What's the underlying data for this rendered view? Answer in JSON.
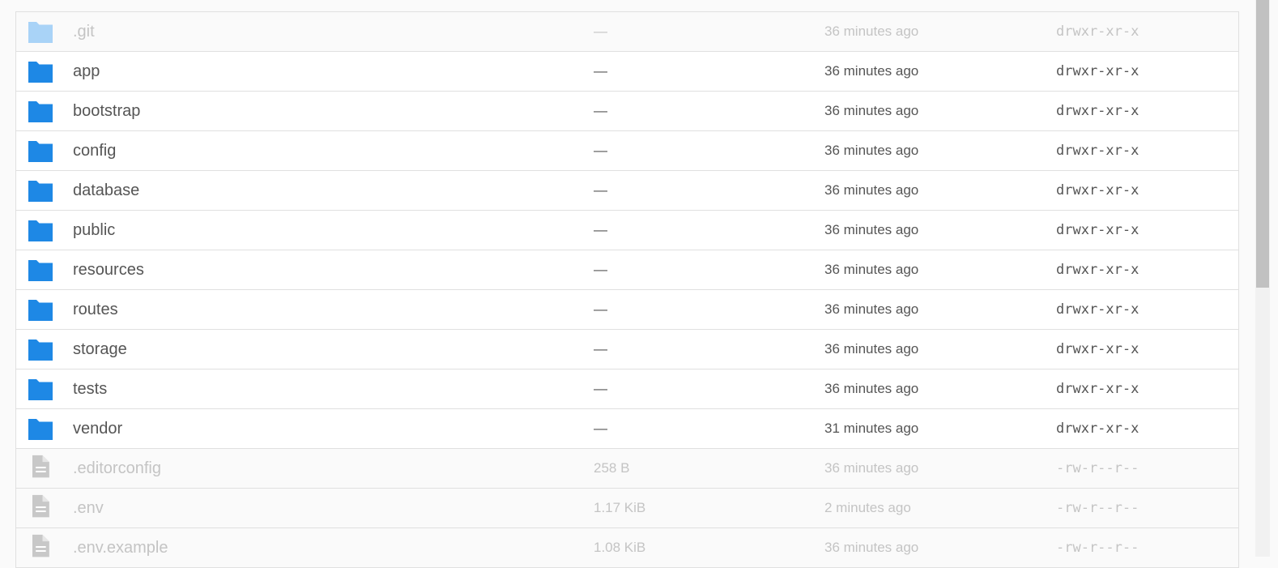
{
  "colors": {
    "folder": "#1e88e5",
    "folder_hidden": "#a9d3f7",
    "file_icon": "#c8c8c8",
    "text": "#555555",
    "text_dim": "#c4c4c4"
  },
  "files": [
    {
      "icon": "folder-icon",
      "name": ".git",
      "size": "—",
      "modified": "36 minutes ago",
      "permissions": "drwxr-xr-x",
      "hidden": true
    },
    {
      "icon": "folder-icon",
      "name": "app",
      "size": "—",
      "modified": "36 minutes ago",
      "permissions": "drwxr-xr-x",
      "hidden": false
    },
    {
      "icon": "folder-icon",
      "name": "bootstrap",
      "size": "—",
      "modified": "36 minutes ago",
      "permissions": "drwxr-xr-x",
      "hidden": false
    },
    {
      "icon": "folder-icon",
      "name": "config",
      "size": "—",
      "modified": "36 minutes ago",
      "permissions": "drwxr-xr-x",
      "hidden": false
    },
    {
      "icon": "folder-icon",
      "name": "database",
      "size": "—",
      "modified": "36 minutes ago",
      "permissions": "drwxr-xr-x",
      "hidden": false
    },
    {
      "icon": "folder-icon",
      "name": "public",
      "size": "—",
      "modified": "36 minutes ago",
      "permissions": "drwxr-xr-x",
      "hidden": false
    },
    {
      "icon": "folder-icon",
      "name": "resources",
      "size": "—",
      "modified": "36 minutes ago",
      "permissions": "drwxr-xr-x",
      "hidden": false
    },
    {
      "icon": "folder-icon",
      "name": "routes",
      "size": "—",
      "modified": "36 minutes ago",
      "permissions": "drwxr-xr-x",
      "hidden": false
    },
    {
      "icon": "folder-icon",
      "name": "storage",
      "size": "—",
      "modified": "36 minutes ago",
      "permissions": "drwxr-xr-x",
      "hidden": false
    },
    {
      "icon": "folder-icon",
      "name": "tests",
      "size": "—",
      "modified": "36 minutes ago",
      "permissions": "drwxr-xr-x",
      "hidden": false
    },
    {
      "icon": "folder-icon",
      "name": "vendor",
      "size": "—",
      "modified": "31 minutes ago",
      "permissions": "drwxr-xr-x",
      "hidden": false
    },
    {
      "icon": "file-icon",
      "name": ".editorconfig",
      "size": "258 B",
      "modified": "36 minutes ago",
      "permissions": "-rw-r--r--",
      "hidden": true
    },
    {
      "icon": "file-icon",
      "name": ".env",
      "size": "1.17 KiB",
      "modified": "2 minutes ago",
      "permissions": "-rw-r--r--",
      "hidden": true
    },
    {
      "icon": "file-icon",
      "name": ".env.example",
      "size": "1.08 KiB",
      "modified": "36 minutes ago",
      "permissions": "-rw-r--r--",
      "hidden": true
    }
  ]
}
